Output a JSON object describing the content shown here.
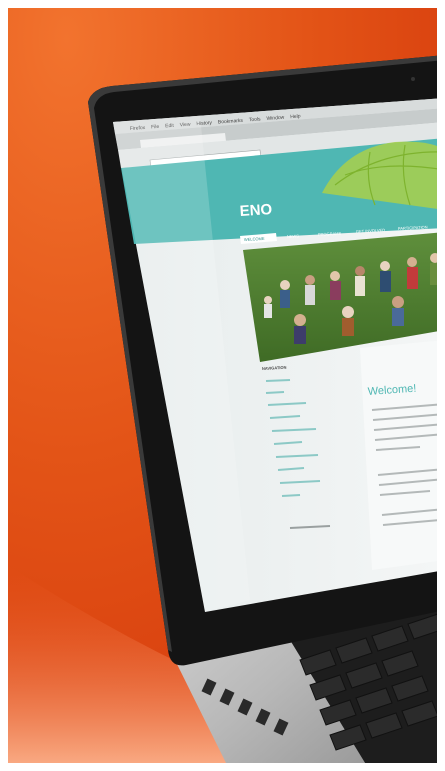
{
  "photo": {
    "subject": "laptop showing a website",
    "colors": {
      "background_orange": "#e8501a",
      "background_light": "#f58a52",
      "screen_teal": "#4fb7b3",
      "aluminium": "#b9b9b9",
      "bezel": "#141414"
    }
  },
  "browser": {
    "menu_items": [
      "Firefox",
      "File",
      "Edit",
      "View",
      "History",
      "Bookmarks",
      "Tools",
      "Window",
      "Help"
    ]
  },
  "website": {
    "logo": "ENO",
    "nav": [
      "WELCOME",
      "NEWS",
      "PROGRAMS",
      "GET INVOLVED",
      "PARTICIPATION"
    ],
    "heading": "Welcome!",
    "sidebar_title": "NAVIGATION"
  }
}
